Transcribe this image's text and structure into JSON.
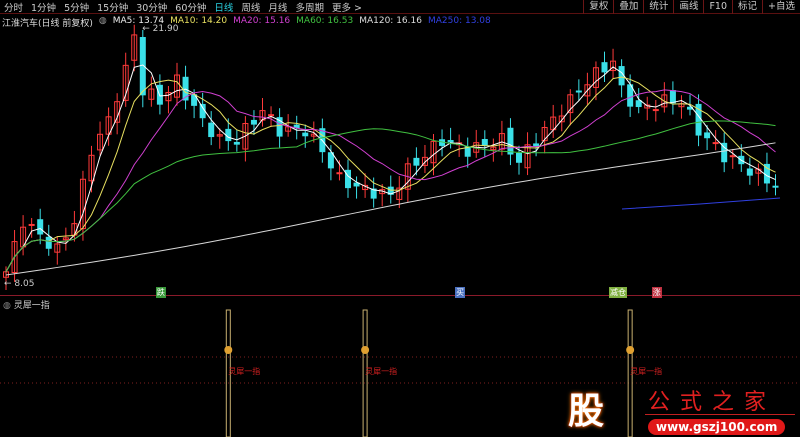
{
  "toolbar": {
    "timeframes": [
      "分时",
      "1分钟",
      "5分钟",
      "15分钟",
      "30分钟",
      "60分钟",
      "日线",
      "周线",
      "月线",
      "多周期",
      "更多 >"
    ],
    "active": "日线",
    "right_buttons": [
      "复权",
      "叠加",
      "统计",
      "画线",
      "F10",
      "标记",
      "+自选"
    ]
  },
  "legend": {
    "title": "江淮汽车(日线 前复权)",
    "ma5": "MA5: 13.74",
    "ma10": "MA10: 14.20",
    "ma20": "MA20: 15.16",
    "ma60": "MA60: 16.53",
    "ma120": "MA120: 16.16",
    "ma250": "MA250: 13.08"
  },
  "colors": {
    "up": "#ff3a3a",
    "down": "#3ae0e8",
    "ma5": "#ffffff",
    "ma10": "#e8e060",
    "ma20": "#d040d0",
    "ma60": "#40c040",
    "ma120": "#d8d8d8",
    "ma250": "#3040e0"
  },
  "chart_data": {
    "type": "candlestick",
    "high_label": "21.90",
    "low_label": "8.05",
    "ylim": [
      8.05,
      21.9
    ],
    "keypoints": [
      [
        0,
        8.5
      ],
      [
        2,
        11.3
      ],
      [
        4,
        10.5
      ],
      [
        6,
        9.7
      ],
      [
        8,
        11.3
      ],
      [
        10,
        15.2
      ],
      [
        12,
        16.8
      ],
      [
        14,
        19.6
      ],
      [
        15,
        21.5
      ],
      [
        16,
        18.5
      ],
      [
        18,
        17.9
      ],
      [
        20,
        19
      ],
      [
        23,
        16.8
      ],
      [
        25,
        15.75
      ],
      [
        27,
        15.75
      ],
      [
        30,
        17.4
      ],
      [
        32,
        16.3
      ],
      [
        35,
        16.3
      ],
      [
        37,
        15.2
      ],
      [
        39,
        13.6
      ],
      [
        42,
        13
      ],
      [
        45,
        12.7
      ],
      [
        47,
        14.1
      ],
      [
        51,
        15.75
      ],
      [
        54,
        15.2
      ],
      [
        58,
        15.75
      ],
      [
        60,
        14.6
      ],
      [
        62,
        15.75
      ],
      [
        65,
        17.4
      ],
      [
        68,
        19
      ],
      [
        71,
        20.1
      ],
      [
        72,
        18.5
      ],
      [
        74,
        17.4
      ],
      [
        77,
        17.9
      ],
      [
        79,
        17.9
      ],
      [
        81,
        16.3
      ],
      [
        84,
        14.9
      ],
      [
        86,
        14.4
      ],
      [
        88,
        13.8
      ],
      [
        90,
        13.3
      ]
    ],
    "signals": [
      {
        "label": "跌",
        "color": "#3a9a3a",
        "index": 18
      },
      {
        "label": "买",
        "color": "#4a70c0",
        "index": 53
      },
      {
        "label": "减仓",
        "color": "#80b040",
        "index": 71
      },
      {
        "label": "涨",
        "color": "#c03040",
        "index": 76
      }
    ]
  },
  "indicator": {
    "title": "灵犀一指",
    "signal_label": "灵犀一指",
    "signals": [
      26,
      42,
      73
    ]
  },
  "watermark": {
    "glyph": "股",
    "name": "公式之家",
    "url": "www.gszj100.com"
  }
}
